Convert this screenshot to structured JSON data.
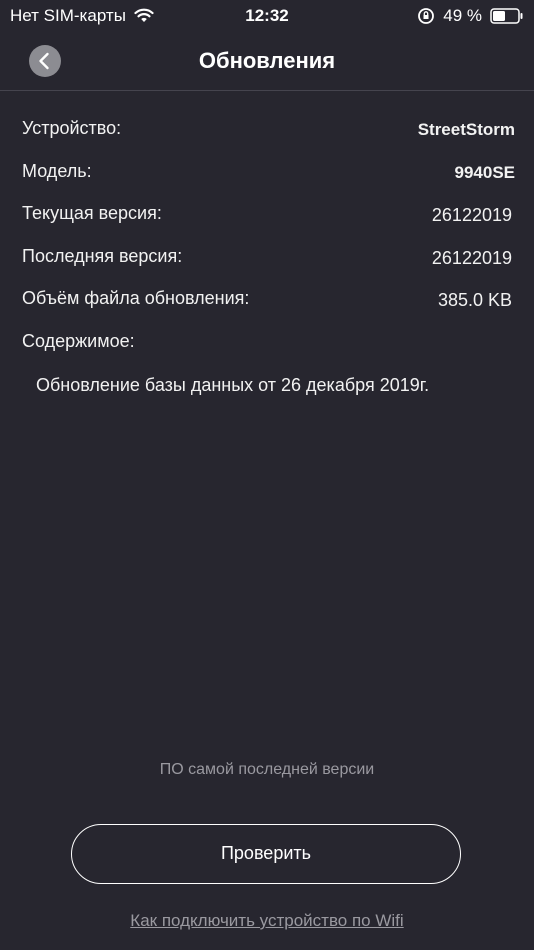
{
  "status_bar": {
    "carrier": "Нет SIM-карты",
    "time": "12:32",
    "battery": "49 %"
  },
  "nav": {
    "title": "Обновления",
    "back_icon": "chevron-left-icon"
  },
  "info": {
    "device_label": "Устройство:",
    "device_value": "StreetStorm",
    "model_label": "Модель:",
    "model_value": "9940SE",
    "current_version_label": "Текущая версия:",
    "current_version_value": "26122019",
    "latest_version_label": "Последняя версия:",
    "latest_version_value": "26122019",
    "file_size_label": "Объём файла обновления:",
    "file_size_value": "385.0 KB",
    "content_label": "Содержимое:",
    "content_text": "Обновление базы данных от 26 декабря 2019г."
  },
  "footer": {
    "status_note": "ПО самой последней версии",
    "check_button": "Проверить",
    "wifi_link": "Как подключить устройство по Wifi"
  },
  "colors": {
    "background": "#27262f",
    "muted_text": "#9a99a0",
    "back_button": "#8c8c92"
  }
}
